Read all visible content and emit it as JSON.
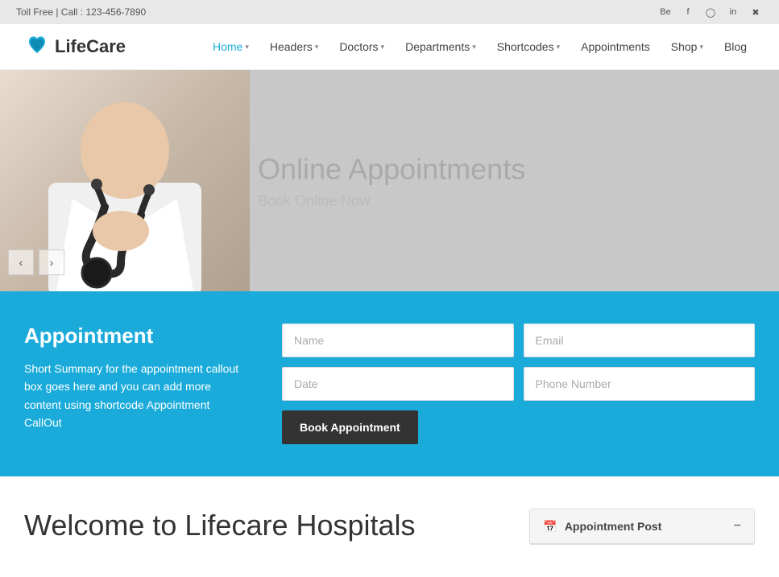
{
  "topbar": {
    "phone_text": "Toll Free | Call : 123-456-7890",
    "social_icons": [
      "be",
      "f",
      "ig",
      "in",
      "tw"
    ]
  },
  "logo": {
    "text_light": "Life",
    "text_bold": "Care"
  },
  "nav": {
    "items": [
      {
        "label": "Home",
        "has_arrow": true,
        "active": true
      },
      {
        "label": "Headers",
        "has_arrow": true,
        "active": false
      },
      {
        "label": "Doctors",
        "has_arrow": true,
        "active": false
      },
      {
        "label": "Departments",
        "has_arrow": true,
        "active": false
      },
      {
        "label": "Shortcodes",
        "has_arrow": true,
        "active": false
      },
      {
        "label": "Appointments",
        "has_arrow": false,
        "active": false
      },
      {
        "label": "Shop",
        "has_arrow": true,
        "active": false
      },
      {
        "label": "Blog",
        "has_arrow": false,
        "active": false
      }
    ]
  },
  "hero": {
    "title": "Online Appointments",
    "subtitle": "Book Online Now"
  },
  "appointment": {
    "title": "Appointment",
    "description": "Short Summary for the appointment callout box goes here and you can add more content using shortcode Appointment CallOut",
    "form": {
      "name_placeholder": "Name",
      "email_placeholder": "Email",
      "date_placeholder": "Date",
      "phone_placeholder": "Phone Number",
      "submit_label": "Book Appointment"
    }
  },
  "welcome": {
    "title": "Welcome to Lifecare Hospitals"
  },
  "sidebar": {
    "widget_title": "Appointment Post",
    "collapse_char": "−"
  }
}
